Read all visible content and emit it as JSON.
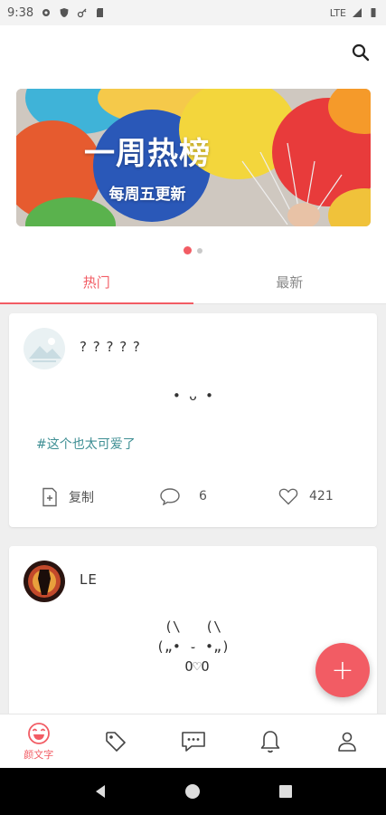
{
  "status_bar": {
    "time": "9:38",
    "network": "LTE"
  },
  "header": {
    "search_icon": "search-icon"
  },
  "banner": {
    "title": "一周热榜",
    "subtitle": "每周五更新",
    "active_index": 0,
    "slide_count": 2
  },
  "tabs": [
    {
      "label": "热门",
      "active": true
    },
    {
      "label": "最新",
      "active": false
    }
  ],
  "feed": [
    {
      "username": "? ? ? ? ?",
      "kaomoji": "• ᴗ •",
      "tag": "#这个也太可爱了",
      "copy_label": "复制",
      "comment_count": "6",
      "like_count": "421"
    },
    {
      "username": "LE",
      "kaomoji": "(\\   (\\\n(„• ֊ •„)\n O♡O"
    }
  ],
  "bottom_nav": [
    {
      "label": "颜文字",
      "icon": "smiley-icon",
      "active": true
    },
    {
      "label": "",
      "icon": "tag-icon",
      "active": false
    },
    {
      "label": "",
      "icon": "chat-icon",
      "active": false
    },
    {
      "label": "",
      "icon": "bell-icon",
      "active": false
    },
    {
      "label": "",
      "icon": "profile-icon",
      "active": false
    }
  ],
  "fab": {
    "label": "+"
  },
  "colors": {
    "accent": "#f25c64",
    "tag": "#3f8f94"
  }
}
